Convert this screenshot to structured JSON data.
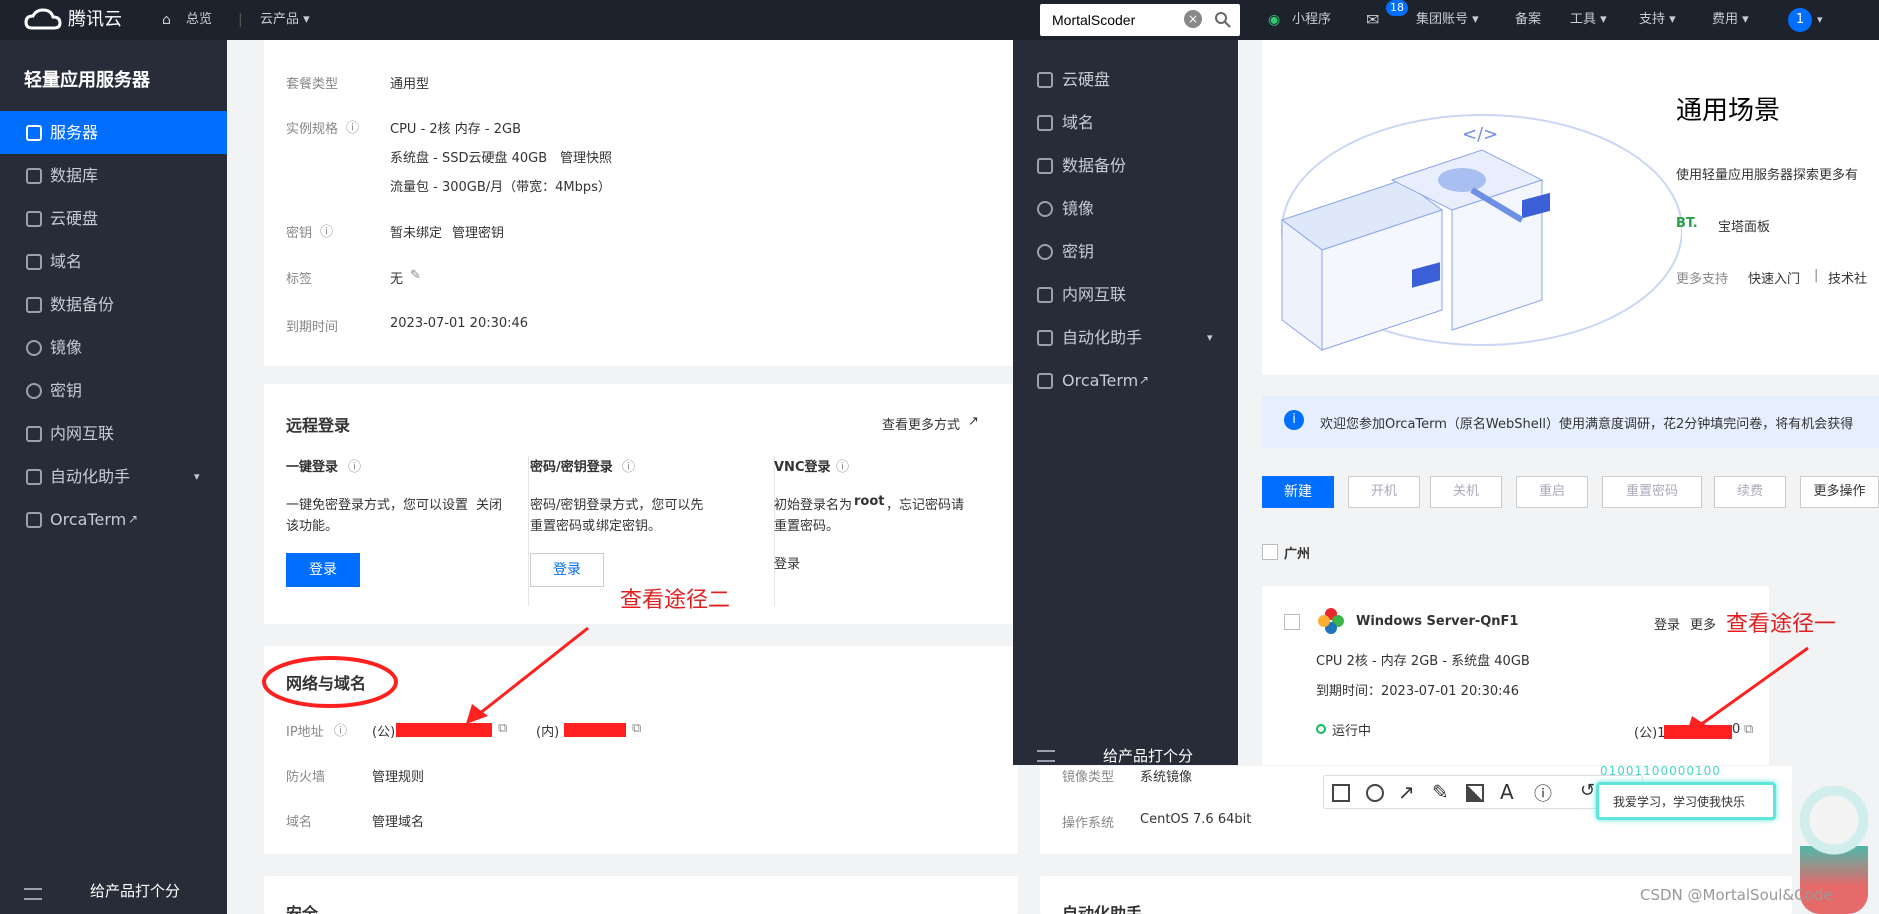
{
  "topbar": {
    "brand": "腾讯云",
    "overview": "总览",
    "products": "云产品 ▾",
    "search_value": "MortalScoder",
    "miniprogram": "小程序",
    "mail_badge": "18",
    "group_account": "集团账号 ▾",
    "filing": "备案",
    "tools": "工具 ▾",
    "support": "支持 ▾",
    "billing": "费用 ▾",
    "avatar": "1"
  },
  "sidebar": {
    "title": "轻量应用服务器",
    "items": [
      {
        "label": "服务器",
        "active": true
      },
      {
        "label": "数据库"
      },
      {
        "label": "云硬盘"
      },
      {
        "label": "域名"
      },
      {
        "label": "数据备份"
      },
      {
        "label": "镜像"
      },
      {
        "label": "密钥"
      },
      {
        "label": "内网互联"
      },
      {
        "label": "自动化助手"
      },
      {
        "label": "OrcaTerm"
      }
    ],
    "rate": "给产品打个分"
  },
  "instance": {
    "pkg_type_label": "套餐类型",
    "pkg_type": "通用型",
    "spec_label": "实例规格",
    "spec_cpu": "CPU - 2核 内存 - 2GB",
    "spec_disk": "系统盘 - SSD云硬盘 40GB",
    "snapshot_link": "管理快照",
    "spec_traffic": "流量包 - 300GB/月（带宽：4Mbps）",
    "key_label": "密钥",
    "key_value": "暂未绑定",
    "key_link": "管理密钥",
    "tag_label": "标签",
    "tag_value": "无",
    "expire_label": "到期时间",
    "expire_value": "2023-07-01 20:30:46"
  },
  "remote": {
    "title": "远程登录",
    "more": "查看更多方式",
    "one_click_title": "一键登录",
    "one_click_desc1": "一键免密登录方式，您可以设置",
    "one_click_close": "关闭",
    "one_click_desc2": "该功能。",
    "login": "登录",
    "pwd_title": "密码/密钥登录",
    "pwd_desc1": "密码/密钥登录方式，您可以先",
    "pwd_reset": "重置密码",
    "pwd_or": "或",
    "pwd_bind": "绑定密钥",
    "pwd_end": "。",
    "vnc_title": "VNC登录",
    "vnc_desc1": "初始登录名为",
    "vnc_root": "root",
    "vnc_desc2": "，忘记密码请",
    "vnc_reset": "重置密码",
    "vnc_end": "。"
  },
  "network": {
    "title": "网络与域名",
    "ip_label": "IP地址",
    "public": "(公)",
    "private": "(内)",
    "firewall_label": "防火墙",
    "firewall_link": "管理规则",
    "domain_label": "域名",
    "domain_link": "管理域名"
  },
  "security_title": "安全",
  "image_panel": {
    "image_type_label": "镜像类型",
    "image_type": "系统镜像",
    "os_label": "操作系统",
    "os": "CentOS 7.6 64bit",
    "auto_title": "自动化助手"
  },
  "overlay": {
    "menu": [
      "云硬盘",
      "域名",
      "数据备份",
      "镜像",
      "密钥",
      "内网互联",
      "自动化助手",
      "OrcaTerm"
    ],
    "rate": "给产品打个分",
    "hero_title": "通用场景",
    "hero_desc": "使用轻量应用服务器探索更多有",
    "bt_logo": "BT.",
    "bt_label": "宝塔面板",
    "more_support": "更多支持",
    "quick_start": "快速入门",
    "sep": "|",
    "tech": "技术社",
    "notice": "欢迎您参加OrcaTerm（原名WebShell）使用满意度调研，花2分钟填完问卷，将有机会获得",
    "btn_new": "新建",
    "btn_start": "开机",
    "btn_stop": "关机",
    "btn_restart": "重启",
    "btn_reset": "重置密码",
    "btn_renew": "续费",
    "btn_more": "更多操作",
    "region": "广州",
    "server_name": "Windows Server-QnF1",
    "server_login": "登录",
    "server_more": "更多",
    "server_spec": "CPU 2核 - 内存 2GB - 系统盘 40GB",
    "server_expire": "到期时间：2023-07-01 20:30:46",
    "server_status": "运行中",
    "server_ip_prefix": "(公)159",
    "server_ip_suffix": "0"
  },
  "annotations": {
    "path_one": "查看途径一",
    "path_two": "查看途径二",
    "binary": "01001100000100",
    "bubble": "我爱学习，学习使我快乐",
    "watermark": "CSDN @MortalSoul&Code"
  }
}
